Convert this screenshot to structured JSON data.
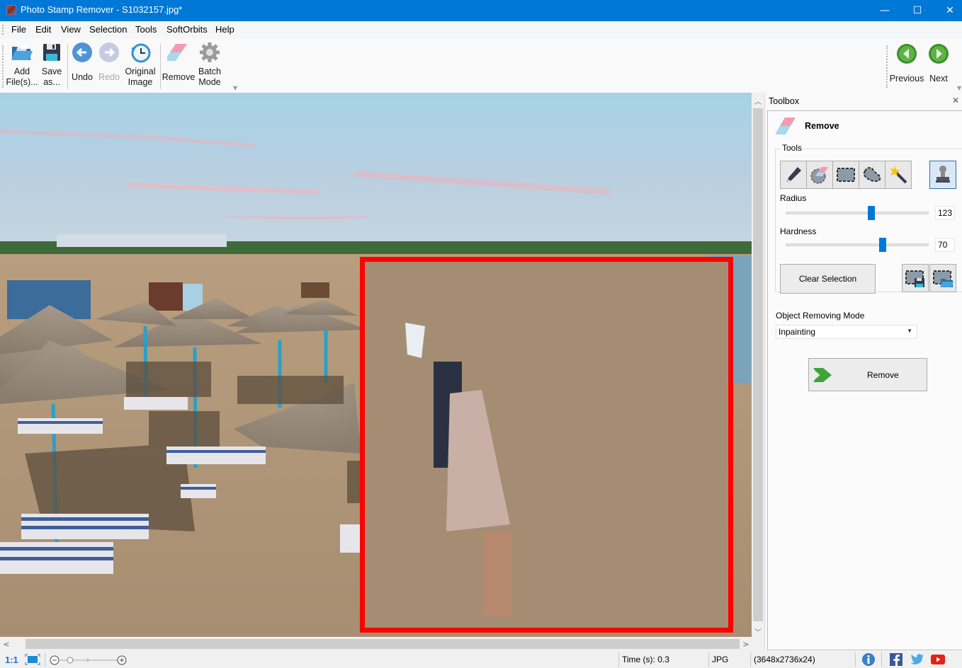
{
  "window": {
    "title": "Photo Stamp Remover - S1032157.jpg*",
    "minimize_glyph": "—",
    "maximize_glyph": "☐",
    "close_glyph": "✕"
  },
  "menu": [
    {
      "label": "File"
    },
    {
      "label": "Edit"
    },
    {
      "label": "View"
    },
    {
      "label": "Selection"
    },
    {
      "label": "Tools"
    },
    {
      "label": "SoftOrbits"
    },
    {
      "label": "Help"
    }
  ],
  "toolbar": {
    "add_files": {
      "line1": "Add",
      "line2": "File(s)..."
    },
    "save_as": {
      "line1": "Save",
      "line2": "as..."
    },
    "undo": {
      "label": "Undo"
    },
    "redo": {
      "label": "Redo",
      "disabled": true
    },
    "original_image": {
      "line1": "Original",
      "line2": "Image"
    },
    "remove": {
      "label": "Remove"
    },
    "batch_mode": {
      "line1": "Batch",
      "line2": "Mode"
    },
    "previous": {
      "label": "Previous"
    },
    "next": {
      "label": "Next"
    }
  },
  "canvas": {
    "image_description": "Beach with straw umbrellas, striped sun loungers, sky; inpainted selection over people",
    "selection_color": "#ff0000"
  },
  "toolbox": {
    "header": "Toolbox",
    "close_glyph": "✕",
    "section_title": "Remove",
    "tools_legend": "Tools",
    "tools": [
      {
        "name": "pencil-tool"
      },
      {
        "name": "eraser-tool"
      },
      {
        "name": "rectangle-select-tool"
      },
      {
        "name": "lasso-tool"
      },
      {
        "name": "magic-wand-tool"
      }
    ],
    "stamp_tool_active": true,
    "radius": {
      "label": "Radius",
      "value": "123",
      "min": 1,
      "max": 200,
      "fraction": 0.6
    },
    "hardness": {
      "label": "Hardness",
      "value": "70",
      "min": 0,
      "max": 100,
      "fraction": 0.68
    },
    "clear_selection_label": "Clear Selection",
    "mode_label": "Object Removing Mode",
    "mode_value": "Inpainting",
    "remove_button_label": "Remove"
  },
  "statusbar": {
    "zoom_actual": "1:1",
    "time_label": "Time (s): 0.3",
    "format": "JPG",
    "dimensions": "(3648x2736x24)"
  },
  "colors": {
    "titlebar": "#0078d7",
    "accent": "#0078d7",
    "nav_green": "#4aa632",
    "selection": "#ff0000"
  }
}
